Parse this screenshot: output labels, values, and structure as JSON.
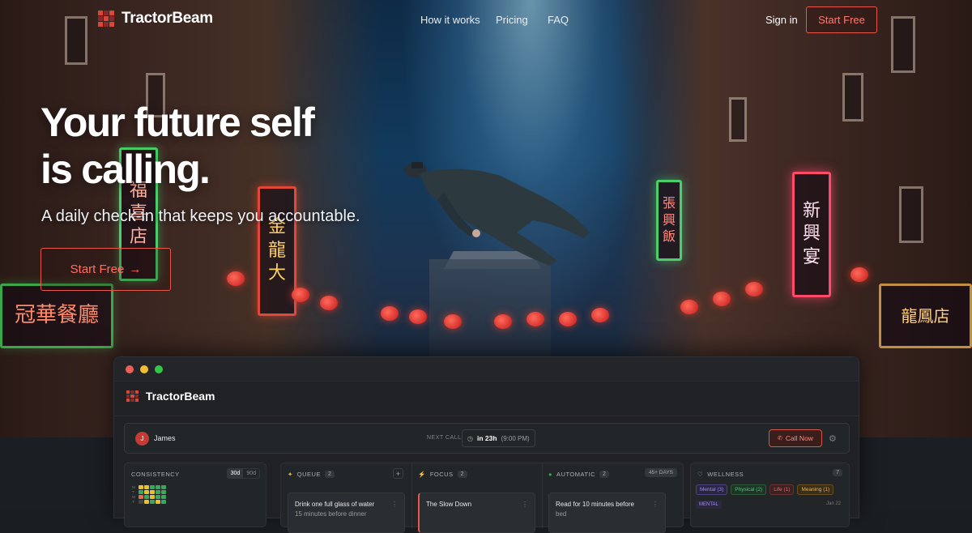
{
  "brand": {
    "name": "TractorBeam",
    "accent": "#e8574a"
  },
  "nav": {
    "links": [
      "How it works",
      "Pricing",
      "FAQ"
    ],
    "sign_in": "Sign in",
    "cta": "Start Free"
  },
  "hero": {
    "headline_line1": "Your future self",
    "headline_line2": "is calling.",
    "subtitle": "A daily check-in that keeps you accountable.",
    "cta": "Start Free",
    "cta_icon": "arrow-right-icon"
  },
  "app": {
    "brand": "TractorBeam",
    "user": {
      "initial": "J",
      "name": "James"
    },
    "next_call": {
      "label": "NEXT CALL",
      "when": "in 23h",
      "time": "(9:00 PM)"
    },
    "call_now": "Call Now",
    "consistency": {
      "title": "CONSISTENCY",
      "range_options": [
        "30d",
        "90d"
      ],
      "selected": "30d",
      "row_labels": [
        "M",
        "T",
        "W",
        "T"
      ]
    },
    "columns": [
      {
        "title": "QUEUE",
        "icon": "sparkle-icon",
        "count": "2",
        "card_line1": "Drink one full glass of water",
        "card_line2": "15 minutes before dinner"
      },
      {
        "title": "FOCUS",
        "icon": "bolt-icon",
        "count": "2",
        "card_line1": "The Slow Down",
        "card_line2": ""
      },
      {
        "title": "AUTOMATIC",
        "icon": "check-circle-icon",
        "count": "2",
        "badge": "45+ DAYS",
        "card_line1": "Read for 10 minutes before",
        "card_line2": "bed"
      }
    ],
    "wellness": {
      "title": "WELLNESS",
      "count": "7",
      "chips": [
        {
          "label": "Mental (3)",
          "color": "#9b8bf0"
        },
        {
          "label": "Physical (2)",
          "color": "#5bc27a"
        },
        {
          "label": "Life (1)",
          "color": "#e86a6a"
        },
        {
          "label": "Meaning (1)",
          "color": "#e8b04a"
        }
      ],
      "entry_tag": "MENTAL",
      "entry_date": "Jan 22"
    }
  }
}
